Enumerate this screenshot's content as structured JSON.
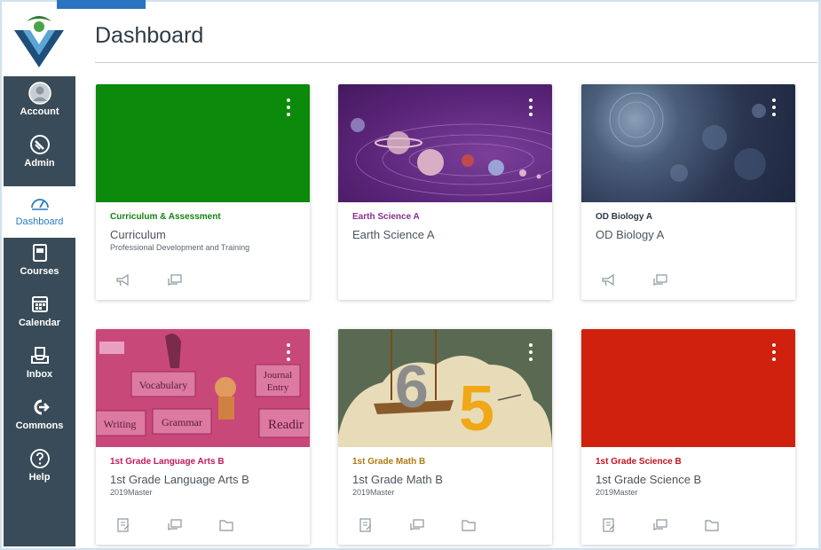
{
  "header": {
    "title": "Dashboard"
  },
  "sidebar": {
    "items": [
      {
        "label": "Account",
        "icon": "account-icon"
      },
      {
        "label": "Admin",
        "icon": "admin-shield-icon"
      },
      {
        "label": "Dashboard",
        "icon": "dashboard-gauge-icon",
        "active": true
      },
      {
        "label": "Courses",
        "icon": "courses-book-icon"
      },
      {
        "label": "Calendar",
        "icon": "calendar-icon"
      },
      {
        "label": "Inbox",
        "icon": "inbox-icon"
      },
      {
        "label": "Commons",
        "icon": "commons-icon"
      },
      {
        "label": "Help",
        "icon": "help-icon"
      }
    ]
  },
  "cards": [
    {
      "code": "Curriculum & Assessment",
      "title": "Curriculum",
      "term": "Professional Development and Training",
      "color": "#0b8a0b",
      "code_color": "#128312",
      "icons": [
        "announcements-icon",
        "discussions-icon"
      ]
    },
    {
      "code": "Earth Science A",
      "title": "Earth Science A",
      "term": "",
      "color": "#6a2f8a",
      "code_color": "#8b2f92",
      "icons": []
    },
    {
      "code": "OD Biology A",
      "title": "OD Biology A",
      "term": "",
      "color": "#2a3550",
      "code_color": "#2d3b45",
      "icons": [
        "announcements-icon",
        "discussions-icon"
      ]
    },
    {
      "code": "1st Grade Language Arts B",
      "title": "1st Grade Language Arts B",
      "term": "2019Master",
      "color": "#d0507a",
      "code_color": "#c2185b",
      "icons": [
        "assignments-icon",
        "discussions-icon",
        "files-icon"
      ],
      "words": [
        "Vocabulary",
        "Journal",
        "Entry",
        "Writing",
        "Grammar",
        "Readir"
      ]
    },
    {
      "code": "1st Grade Math B",
      "title": "1st Grade Math B",
      "term": "2019Master",
      "color": "#5c6b55",
      "code_color": "#b07a12",
      "icons": [
        "assignments-icon",
        "discussions-icon",
        "files-icon"
      ]
    },
    {
      "code": "1st Grade Science B",
      "title": "1st Grade Science B",
      "term": "2019Master",
      "color": "#d0210f",
      "code_color": "#c1121f",
      "icons": [
        "assignments-icon",
        "discussions-icon",
        "files-icon"
      ]
    }
  ]
}
